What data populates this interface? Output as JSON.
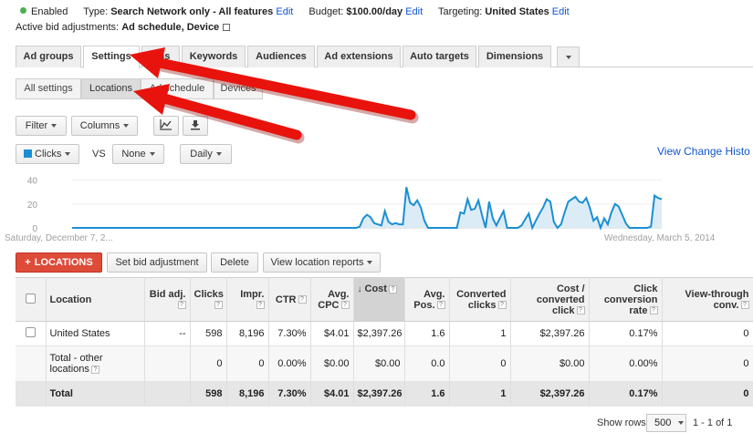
{
  "status": {
    "enabled": "Enabled",
    "type_label": "Type:",
    "type_value": "Search Network only - All features",
    "budget_label": "Budget:",
    "budget_value": "$100.00/day",
    "targeting_label": "Targeting:",
    "targeting_value": "United States",
    "edit": "Edit"
  },
  "bid_adjustments": {
    "label": "Active bid adjustments:",
    "value": "Ad schedule, Device"
  },
  "tabs": [
    "Ad groups",
    "Settings",
    "Ads",
    "Keywords",
    "Audiences",
    "Ad extensions",
    "Auto targets",
    "Dimensions"
  ],
  "subtabs": [
    "All settings",
    "Locations",
    "Ad schedule",
    "Devices"
  ],
  "toolbar": {
    "filter": "Filter",
    "columns": "Columns",
    "metric1": "Clicks",
    "vs": "VS",
    "metric2": "None",
    "period": "Daily",
    "history_link": "View Change Histo"
  },
  "chart_data": {
    "type": "area",
    "series": [
      {
        "name": "Clicks",
        "values": [
          0,
          0,
          0,
          0,
          0,
          0,
          0,
          0,
          0,
          0,
          0,
          0,
          0,
          0,
          0,
          0,
          0,
          0,
          0,
          0,
          0,
          0,
          0,
          0,
          0,
          0,
          0,
          0,
          0,
          0,
          0,
          0,
          0,
          0,
          0,
          0,
          0,
          0,
          0,
          0,
          0,
          0,
          0,
          0,
          0,
          0,
          0,
          0,
          0,
          0,
          0,
          0,
          0,
          0,
          0,
          0,
          0,
          0,
          0,
          0,
          0,
          0,
          0,
          0,
          0,
          0,
          0,
          0,
          0,
          0,
          0,
          0,
          0,
          0,
          0,
          0,
          0,
          0,
          0,
          0,
          1,
          8,
          11,
          9,
          4,
          3,
          2,
          14,
          5,
          3,
          4,
          3,
          3,
          34,
          21,
          19,
          23,
          17,
          6,
          0,
          0,
          0,
          0,
          0,
          0,
          0,
          0,
          0,
          13,
          12,
          24,
          15,
          16,
          23,
          11,
          0,
          22,
          8,
          2,
          8,
          14,
          0,
          0,
          0,
          0,
          2,
          7,
          12,
          0,
          6,
          12,
          17,
          24,
          22,
          5,
          0,
          3,
          13,
          22,
          24,
          26,
          22,
          21,
          25,
          17,
          6,
          9,
          0,
          8,
          3,
          13,
          20,
          18,
          11,
          4,
          0,
          0,
          0,
          0,
          0,
          0,
          1,
          27,
          25,
          24
        ]
      }
    ],
    "y_ticks": [
      0,
      20,
      40
    ],
    "ylim": [
      0,
      45
    ],
    "x_start_label": "Saturday, December 7, 2...",
    "x_end_label": "Wednesday, March 5, 2014",
    "color": "#1b8fd3",
    "fill": "#dcecf6"
  },
  "actions": {
    "add_locations": "Locations",
    "set_bid": "Set bid adjustment",
    "delete": "Delete",
    "view_reports": "View location reports"
  },
  "table": {
    "headers": {
      "location": "Location",
      "bid_adj": "Bid adj.",
      "clicks": "Clicks",
      "impr": "Impr.",
      "ctr": "CTR",
      "cpc": "Avg. CPC",
      "cost": "Cost",
      "pos": "Avg. Pos.",
      "conv": "Converted clicks",
      "cost_conv": "Cost / converted click",
      "conv_rate": "Click conversion rate",
      "vtc": "View-through conv."
    },
    "rows": [
      {
        "location": "United States",
        "bid_adj": "--",
        "clicks": "598",
        "impr": "8,196",
        "ctr": "7.30%",
        "cpc": "$4.01",
        "cost": "$2,397.26",
        "pos": "1.6",
        "conv": "1",
        "cost_conv": "$2,397.26",
        "conv_rate": "0.17%",
        "vtc": "0"
      },
      {
        "location": "Total - other locations",
        "bid_adj": "",
        "clicks": "0",
        "impr": "0",
        "ctr": "0.00%",
        "cpc": "$0.00",
        "cost": "$0.00",
        "pos": "0.0",
        "conv": "0",
        "cost_conv": "$0.00",
        "conv_rate": "0.00%",
        "vtc": "0"
      }
    ],
    "total": {
      "location": "Total",
      "clicks": "598",
      "impr": "8,196",
      "ctr": "7.30%",
      "cpc": "$4.01",
      "cost": "$2,397.26",
      "pos": "1.6",
      "conv": "1",
      "cost_conv": "$2,397.26",
      "conv_rate": "0.17%",
      "vtc": "0"
    }
  },
  "footer": {
    "show_rows": "Show rows:",
    "rows_value": "500",
    "range": "1 - 1 of 1"
  },
  "colors": {
    "accent_red": "#dd4b39",
    "arrow_red": "#e8130c",
    "link_blue": "#1155cc",
    "series_blue": "#1b8fd3"
  }
}
